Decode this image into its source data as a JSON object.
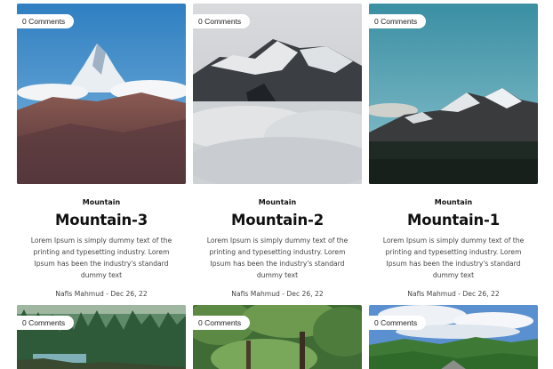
{
  "posts": [
    {
      "comments": "0 Comments",
      "category": "Mountain",
      "title": "Mountain-3",
      "excerpt": "Lorem Ipsum is simply dummy text of the printing and typesetting industry. Lorem Ipsum has been the industry's standard dummy text",
      "author": "Nafis Mahmud",
      "date": "Dec 26, 22",
      "image": "snowy-peak-blue-sky-photo"
    },
    {
      "comments": "0 Comments",
      "category": "Mountain",
      "title": "Mountain-2",
      "excerpt": "Lorem Ipsum is simply dummy text of the printing and typesetting industry. Lorem Ipsum has been the industry's standard dummy text",
      "author": "Nafis Mahmud",
      "date": "Dec 26, 22",
      "image": "misty-mountain-ridge-photo"
    },
    {
      "comments": "0 Comments",
      "category": "Mountain",
      "title": "Mountain-1",
      "excerpt": "Lorem Ipsum is simply dummy text of the printing and typesetting industry. Lorem Ipsum has been the industry's standard dummy text",
      "author": "Nafis Mahmud",
      "date": "Dec 26, 22",
      "image": "dark-mountain-teal-sky-photo"
    },
    {
      "comments": "0 Comments",
      "image": "pine-forest-lake-photo"
    },
    {
      "comments": "0 Comments",
      "image": "green-forest-trees-photo"
    },
    {
      "comments": "0 Comments",
      "image": "green-hills-cloudy-sky-photo"
    }
  ],
  "colors": {
    "text": "#222222",
    "muted": "#444444",
    "background": "#ffffff"
  }
}
